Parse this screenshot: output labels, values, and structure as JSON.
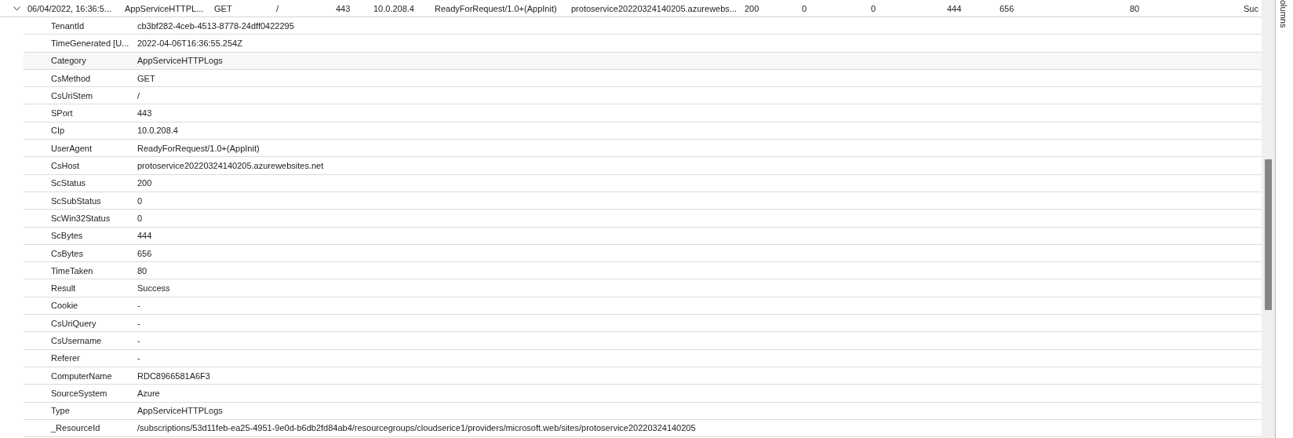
{
  "summary_row": {
    "expanded": true,
    "cells": [
      "06/04/2022, 16:36:5...",
      "AppServiceHTTPL...",
      "GET",
      "/",
      "443",
      "10.0.208.4",
      "ReadyForRequest/1.0+(AppInit)",
      "protoservice20220324140205.azurewebs...",
      "200",
      "0",
      "0",
      "444",
      "656",
      "80",
      "Suc"
    ]
  },
  "details": [
    {
      "name": "TenantId",
      "value": "cb3bf282-4ceb-4513-8778-24dff0422295",
      "hovered": false
    },
    {
      "name": "TimeGenerated [U...",
      "value": "2022-04-06T16:36:55.254Z",
      "hovered": false
    },
    {
      "name": "Category",
      "value": "AppServiceHTTPLogs",
      "hovered": true
    },
    {
      "name": "CsMethod",
      "value": "GET",
      "hovered": false
    },
    {
      "name": "CsUriStem",
      "value": "/",
      "hovered": false
    },
    {
      "name": "SPort",
      "value": "443",
      "hovered": false
    },
    {
      "name": "CIp",
      "value": "10.0.208.4",
      "hovered": false
    },
    {
      "name": "UserAgent",
      "value": "ReadyForRequest/1.0+(AppInit)",
      "hovered": false
    },
    {
      "name": "CsHost",
      "value": "protoservice20220324140205.azurewebsites.net",
      "hovered": false
    },
    {
      "name": "ScStatus",
      "value": "200",
      "hovered": false
    },
    {
      "name": "ScSubStatus",
      "value": "0",
      "hovered": false
    },
    {
      "name": "ScWin32Status",
      "value": "0",
      "hovered": false
    },
    {
      "name": "ScBytes",
      "value": "444",
      "hovered": false
    },
    {
      "name": "CsBytes",
      "value": "656",
      "hovered": false
    },
    {
      "name": "TimeTaken",
      "value": "80",
      "hovered": false
    },
    {
      "name": "Result",
      "value": "Success",
      "hovered": false
    },
    {
      "name": "Cookie",
      "value": "-",
      "hovered": false
    },
    {
      "name": "CsUriQuery",
      "value": "-",
      "hovered": false
    },
    {
      "name": "CsUsername",
      "value": "-",
      "hovered": false
    },
    {
      "name": "Referer",
      "value": "-",
      "hovered": false
    },
    {
      "name": "ComputerName",
      "value": "RDC8966581A6F3",
      "hovered": false
    },
    {
      "name": "SourceSystem",
      "value": "Azure",
      "hovered": false
    },
    {
      "name": "Type",
      "value": "AppServiceHTTPLogs",
      "hovered": false
    },
    {
      "name": "_ResourceId",
      "value": "/subscriptions/53d11feb-ea25-4951-9e0d-b6db2fd84ab4/resourcegroups/cloudserice1/providers/microsoft.web/sites/protoservice20220324140205",
      "hovered": false
    }
  ],
  "side_panel": {
    "label": "olumns"
  }
}
